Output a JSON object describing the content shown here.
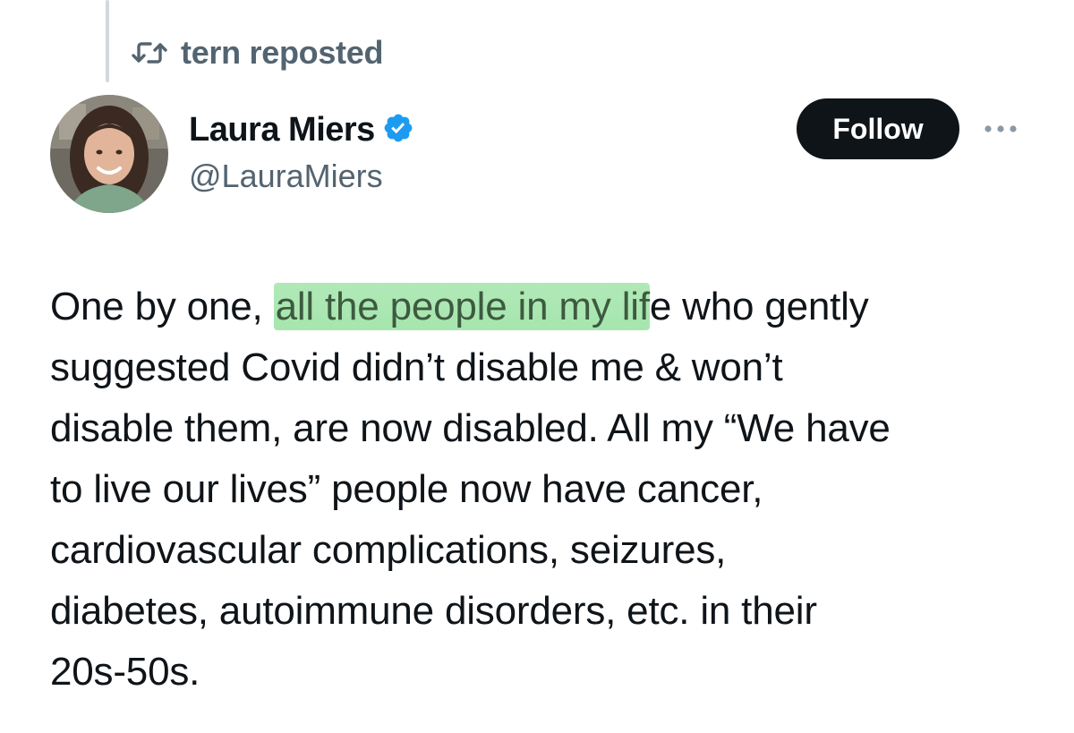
{
  "repost": {
    "label": "tern reposted",
    "icon": "repost-icon"
  },
  "author": {
    "display_name": "Laura Miers",
    "handle": "@LauraMiers",
    "verified": true,
    "verified_color": "#1d9bf0"
  },
  "actions": {
    "follow_label": "Follow",
    "more_icon": "more-dots-icon"
  },
  "tweet": {
    "lines": [
      {
        "before": "One by one, ",
        "highlight": "all the people in my lif",
        "after": "e who gently"
      },
      {
        "text": "suggested Covid didn’t disable me & won’t"
      },
      {
        "text": "disable them, are now disabled. All my “We have"
      },
      {
        "text": "to live our lives” people now have cancer,"
      },
      {
        "text": "cardiovascular complications, seizures,"
      },
      {
        "text": "diabetes, autoimmune disorders, etc. in their"
      },
      {
        "text": "20s-50s."
      }
    ]
  },
  "colors": {
    "text": "#0f1419",
    "secondary": "#536471",
    "highlight": "#a8e6ae",
    "follow_bg": "#0f1419"
  }
}
